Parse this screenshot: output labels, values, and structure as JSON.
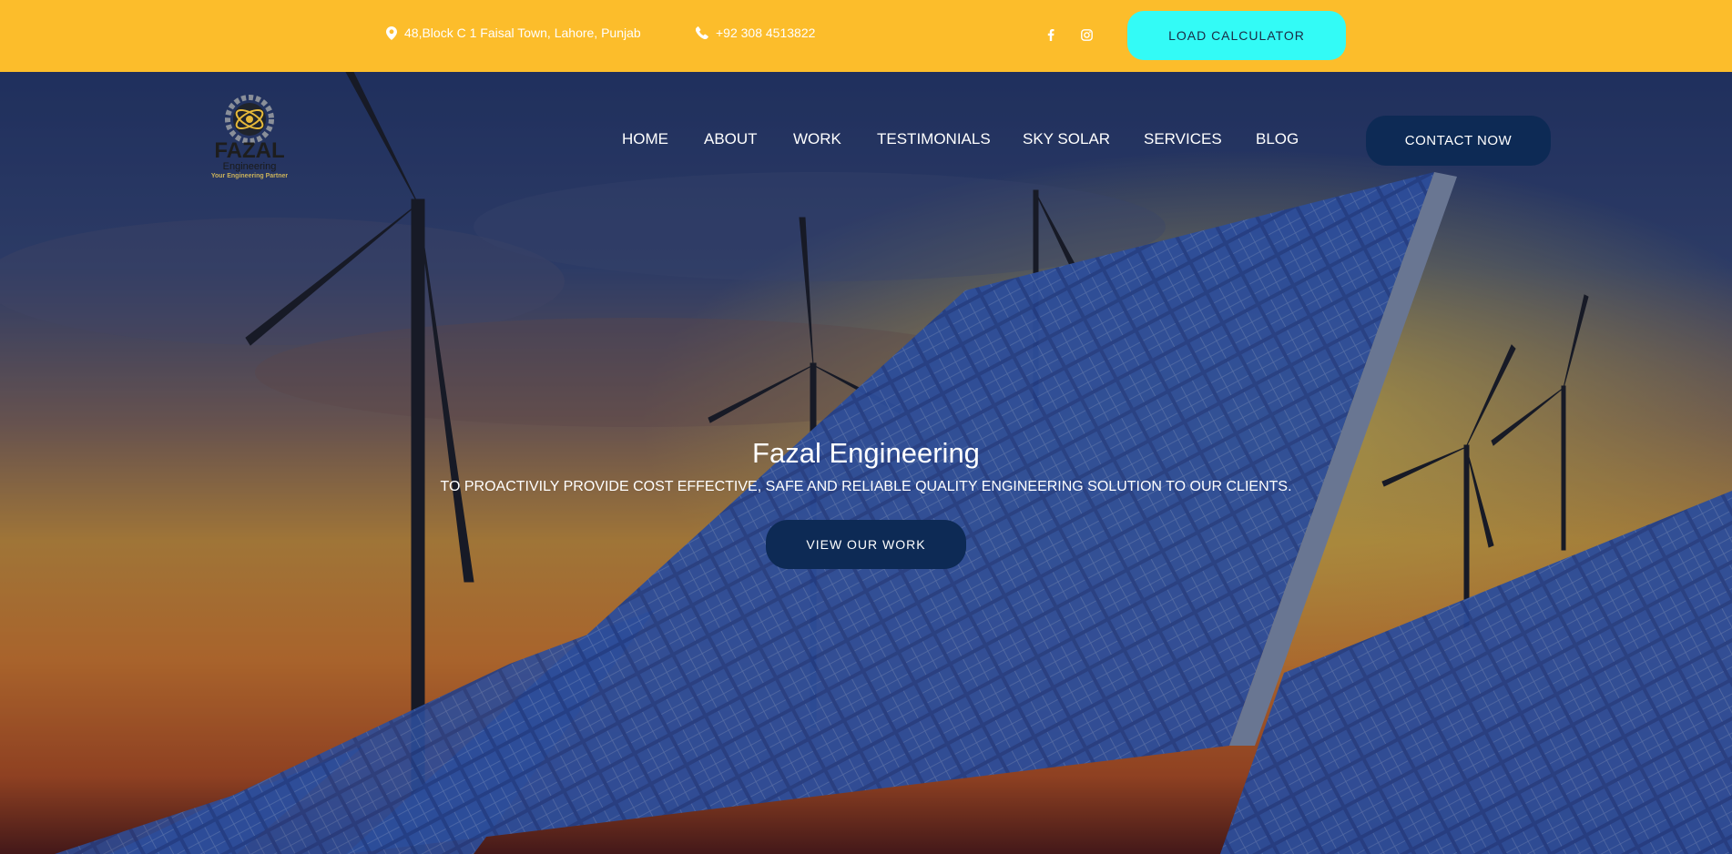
{
  "topbar": {
    "address": "48,Block C 1 Faisal Town, Lahore, Punjab",
    "phone": "+92 308 4513822",
    "social": {
      "facebook_icon": "f",
      "instagram_icon": "instagram"
    },
    "load_calculator": "LOAD CALCULATOR",
    "background_color": "#fcbd2b",
    "button_color": "#33fbf6"
  },
  "logo": {
    "name": "FAZAL",
    "sub": "Engineering",
    "tagline": "Your Engineering Partner"
  },
  "nav": {
    "items": [
      "HOME",
      "ABOUT",
      "WORK",
      "TESTIMONIALS",
      "SKY SOLAR",
      "SERVICES",
      "BLOG"
    ],
    "contact": "CONTACT NOW",
    "accent_color": "#0d2a55"
  },
  "hero": {
    "title": "Fazal Engineering",
    "subtitle": "TO PROACTIVILY PROVIDE COST EFFECTIVE, SAFE AND RELIABLE QUALITY ENGINEERING SOLUTION TO OUR CLIENTS.",
    "cta": "VIEW OUR WORK"
  }
}
